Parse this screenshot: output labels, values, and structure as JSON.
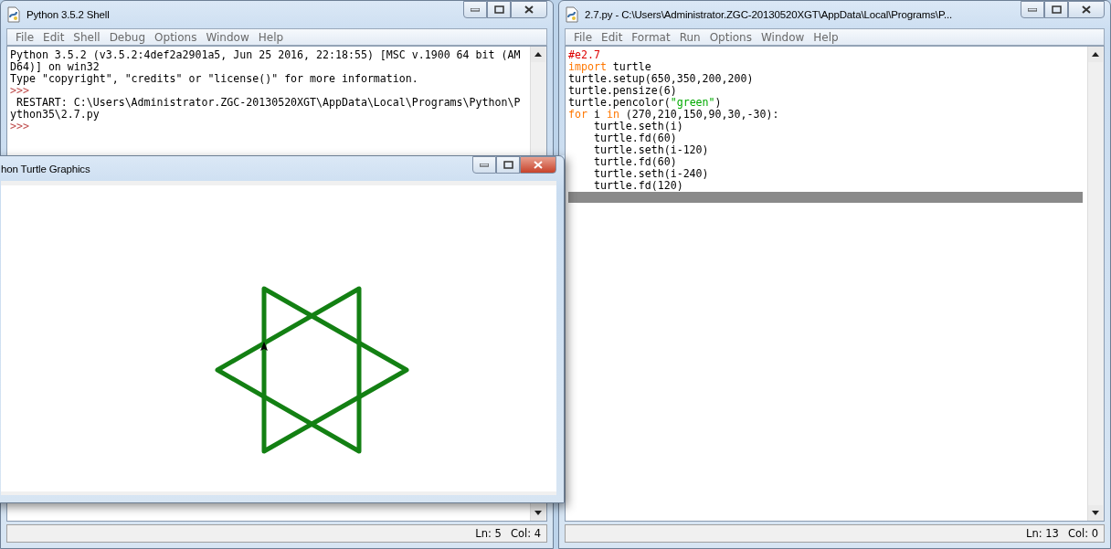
{
  "shell": {
    "title": "Python 3.5.2 Shell",
    "menu": [
      "File",
      "Edit",
      "Shell",
      "Debug",
      "Options",
      "Window",
      "Help"
    ],
    "lines": [
      {
        "kind": "output",
        "text": "Python 3.5.2 (v3.5.2:4def2a2901a5, Jun 25 2016, 22:18:55) [MSC v.1900 64 bit (AM"
      },
      {
        "kind": "output",
        "text": "D64)] on win32"
      },
      {
        "kind": "output",
        "text": "Type \"copyright\", \"credits\" or \"license()\" for more information."
      },
      {
        "kind": "prompt",
        "text": ">>>"
      },
      {
        "kind": "output",
        "text": " RESTART: C:\\Users\\Administrator.ZGC-20130520XGT\\AppData\\Local\\Programs\\Python\\P"
      },
      {
        "kind": "output",
        "text": "ython35\\2.7.py"
      },
      {
        "kind": "prompt",
        "text": ">>>"
      }
    ],
    "status": {
      "line": "Ln: 5",
      "col": "Col: 4"
    }
  },
  "turtle": {
    "title": "hon Turtle Graphics"
  },
  "editor": {
    "title": "2.7.py - C:\\Users\\Administrator.ZGC-20130520XGT\\AppData\\Local\\Programs\\P...",
    "menu": [
      "File",
      "Edit",
      "Format",
      "Run",
      "Options",
      "Window",
      "Help"
    ],
    "lines": [
      [
        {
          "kind": "comment",
          "text": "#e2.7"
        }
      ],
      [
        {
          "kind": "keyword",
          "text": "import"
        },
        {
          "kind": "plain",
          "text": " turtle"
        }
      ],
      [
        {
          "kind": "plain",
          "text": "turtle.setup(650,350,200,200)"
        }
      ],
      [
        {
          "kind": "plain",
          "text": "turtle.pensize(6)"
        }
      ],
      [
        {
          "kind": "plain",
          "text": "turtle.pencolor("
        },
        {
          "kind": "string",
          "text": "\"green\""
        },
        {
          "kind": "plain",
          "text": ")"
        }
      ],
      [
        {
          "kind": "keyword",
          "text": "for"
        },
        {
          "kind": "plain",
          "text": " i "
        },
        {
          "kind": "keyword",
          "text": "in"
        },
        {
          "kind": "plain",
          "text": " (270,210,150,90,30,-30):"
        }
      ],
      [
        {
          "kind": "plain",
          "text": "    turtle.seth(i)"
        }
      ],
      [
        {
          "kind": "plain",
          "text": "    turtle.fd(60)"
        }
      ],
      [
        {
          "kind": "plain",
          "text": "    turtle.seth(i-120)"
        }
      ],
      [
        {
          "kind": "plain",
          "text": "    turtle.fd(60)"
        }
      ],
      [
        {
          "kind": "plain",
          "text": "    turtle.seth(i-240)"
        }
      ],
      [
        {
          "kind": "plain",
          "text": "    turtle.fd(120)"
        }
      ]
    ],
    "status": {
      "line": "Ln: 13",
      "col": "Col: 0"
    }
  }
}
